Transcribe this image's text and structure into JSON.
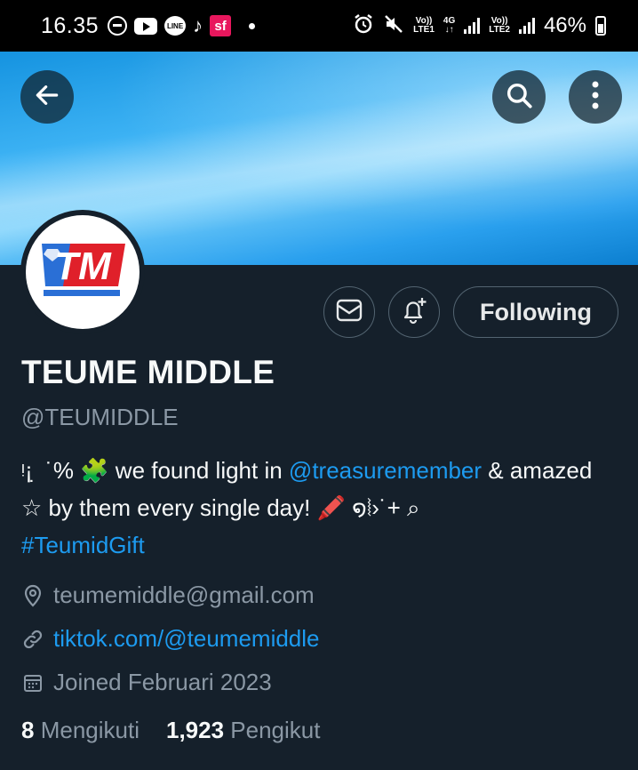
{
  "status_bar": {
    "time": "16.35",
    "line_label": "LINE",
    "tiktok_glyph": "♪",
    "sf_label": "sf",
    "sim1_top": "Vo))",
    "sim1_bottom": "LTE1",
    "net_top": "4G",
    "net_bottom": "↓↑",
    "sim2_top": "Vo))",
    "sim2_bottom": "LTE2",
    "battery": "46%"
  },
  "header": {
    "back_icon": "arrow-left-icon",
    "search_icon": "search-icon",
    "more_icon": "more-vertical-icon"
  },
  "profile": {
    "avatar_text": "TM",
    "name": "TEUME MIDDLE",
    "handle": "@TEUMIDDLE",
    "follow_label": "Following",
    "bio": {
      "prefix": "ᵎ¡ ̣ ˙% 🧩 we found light in ",
      "mention": "@treasuremember",
      "middle": " & amazed ☆ by them every single day! 🖍️ ໑⦚›˙+ ⌕",
      "hashtag": "#TeumidGift"
    },
    "email": "teumemiddle@gmail.com",
    "website": "tiktok.com/@teumemiddle",
    "joined": "Joined Februari 2023",
    "following_count": "8",
    "following_label": "Mengikuti",
    "followers_count": "1,923",
    "followers_label": "Pengikut"
  },
  "colors": {
    "background": "#15202b",
    "link": "#1d9bf0",
    "muted": "#8b98a5",
    "avatar_red": "#e0202a",
    "avatar_blue": "#2a6fd6"
  }
}
